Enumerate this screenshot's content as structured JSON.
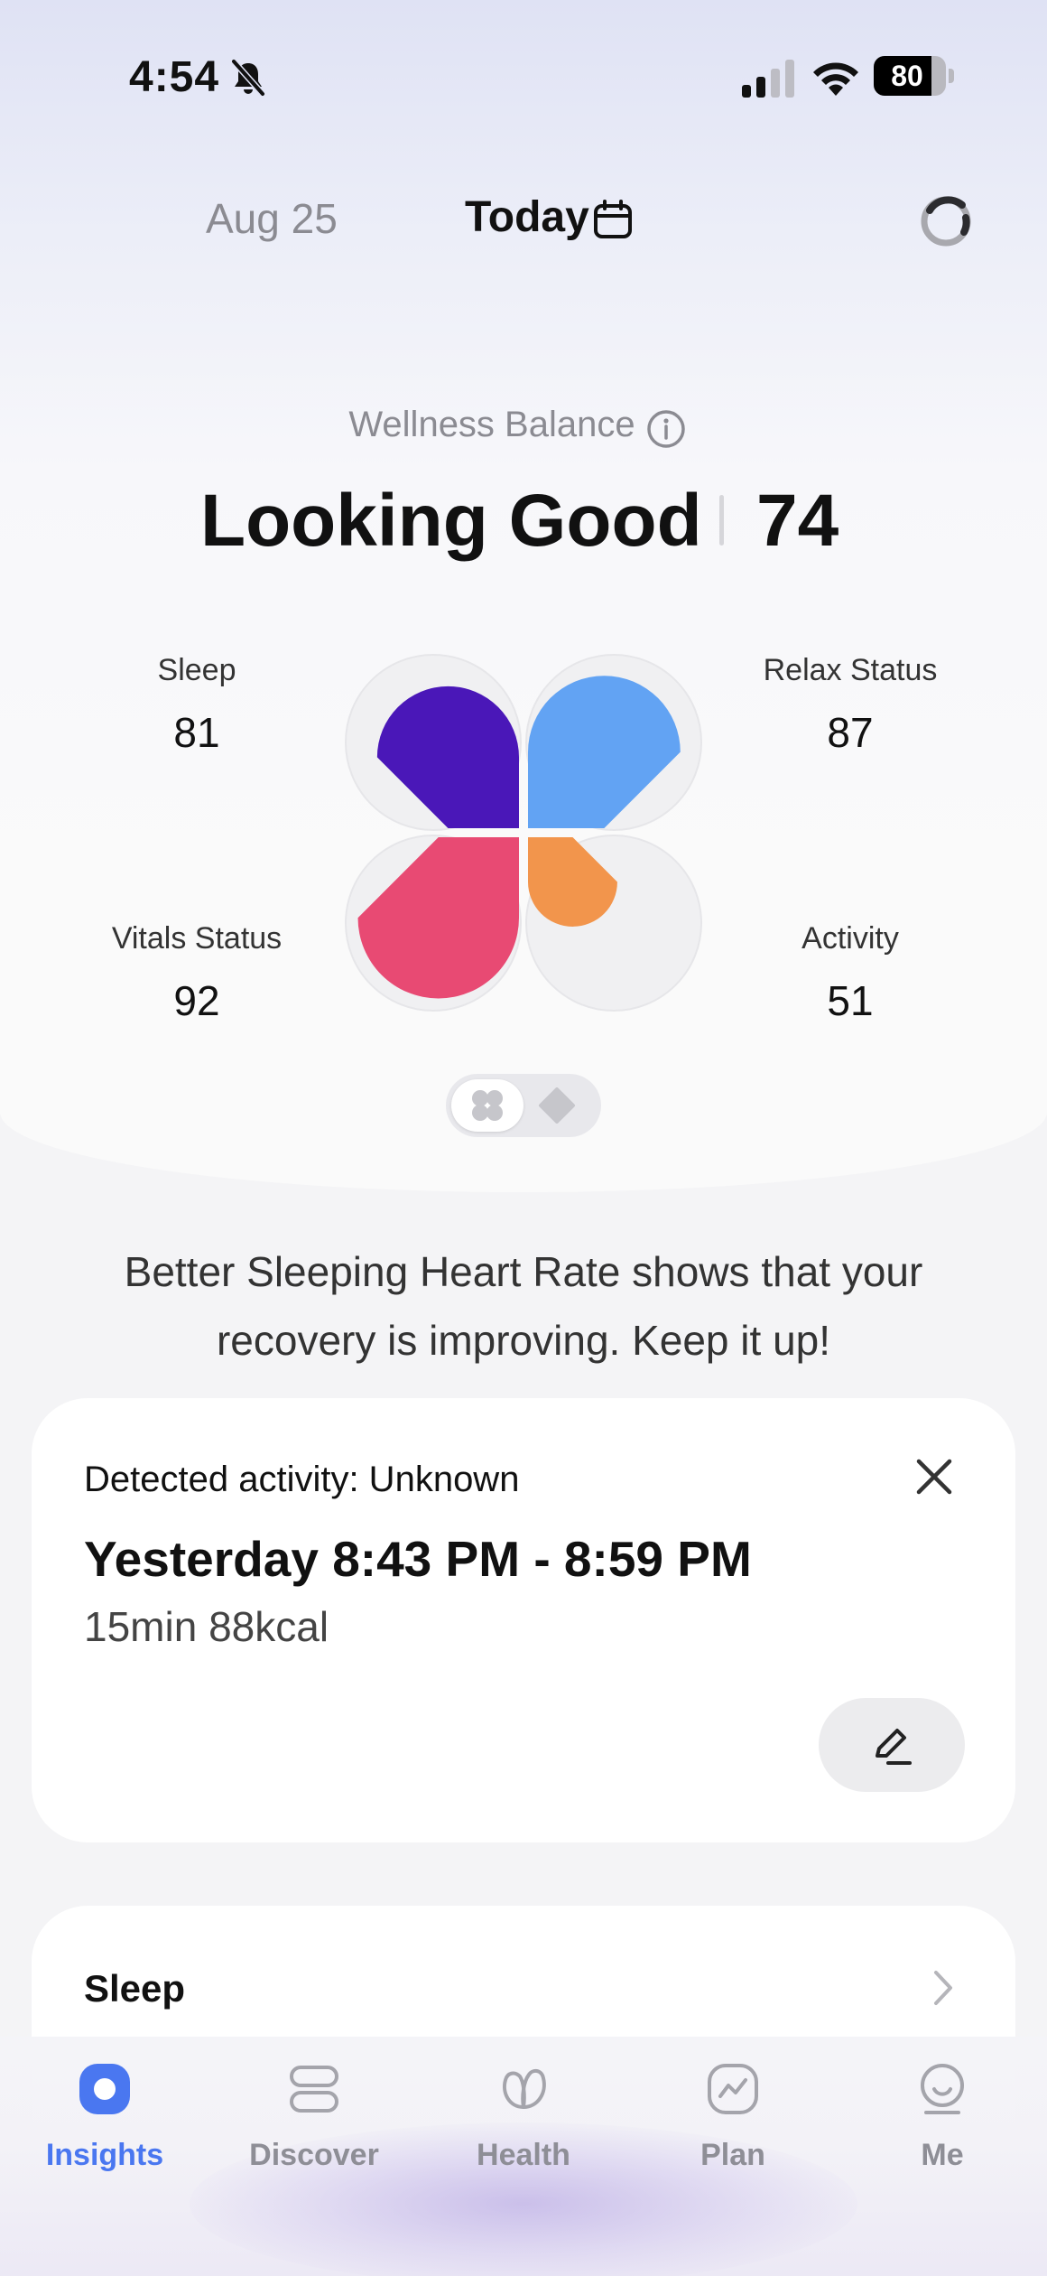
{
  "status_bar": {
    "time": "4:54",
    "battery": "80",
    "battery_level": 0.8
  },
  "header": {
    "prev_date": "Aug 25",
    "current_date": "Today"
  },
  "wellness": {
    "label": "Wellness Balance",
    "status": "Looking Good",
    "score": "74",
    "metrics": [
      {
        "label": "Sleep",
        "value": "81",
        "color": "#4a17b8"
      },
      {
        "label": "Relax Status",
        "value": "87",
        "color": "#62a3f3"
      },
      {
        "label": "Vitals Status",
        "value": "92",
        "color": "#e84a73"
      },
      {
        "label": "Activity",
        "value": "51",
        "color": "#f2954c"
      }
    ]
  },
  "message": "Better Sleeping Heart Rate shows that your recovery is improving. Keep it up!",
  "activity_card": {
    "detected": "Detected activity: Unknown",
    "time_range": "Yesterday 8:43 PM - 8:59 PM",
    "summary": "15min 88kcal"
  },
  "sleep_card": {
    "title": "Sleep"
  },
  "tabs": [
    {
      "label": "Insights",
      "icon": "insights-icon",
      "active": true
    },
    {
      "label": "Discover",
      "icon": "discover-icon",
      "active": false
    },
    {
      "label": "Health",
      "icon": "health-icon",
      "active": false
    },
    {
      "label": "Plan",
      "icon": "plan-icon",
      "active": false
    },
    {
      "label": "Me",
      "icon": "me-icon",
      "active": false
    }
  ],
  "colors": {
    "accent": "#4a77f0",
    "inactive": "#8e8e96"
  }
}
